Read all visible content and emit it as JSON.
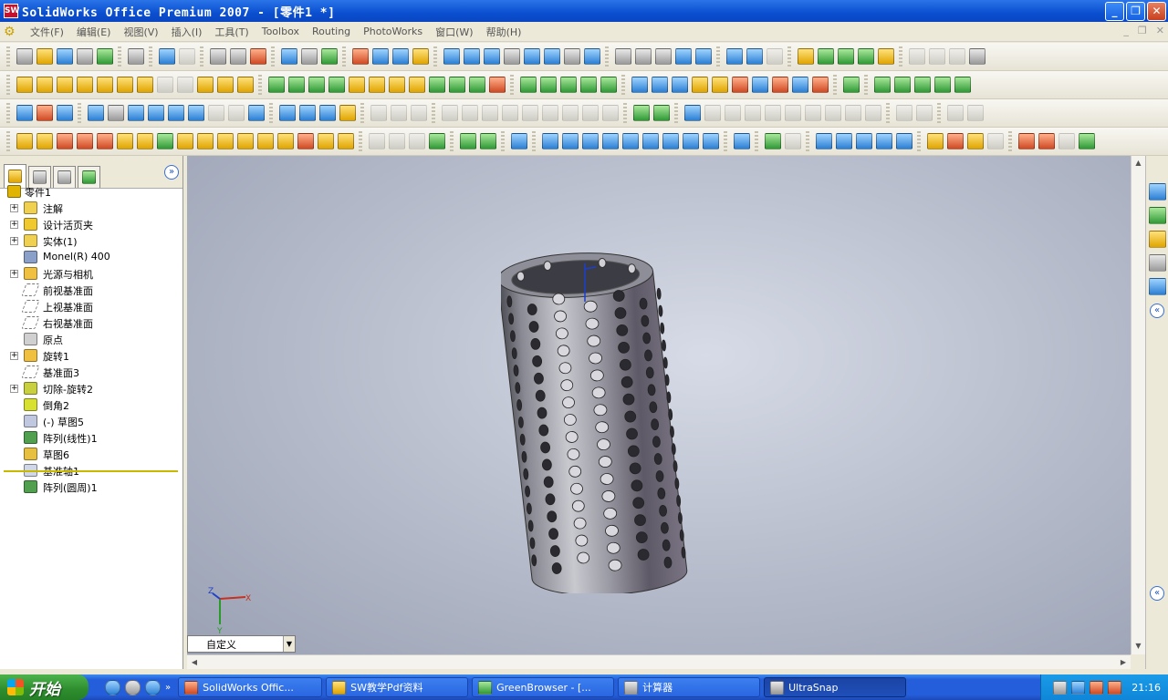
{
  "window": {
    "title": "SolidWorks Office Premium 2007 - [零件1 *]",
    "app_icon": "SW"
  },
  "window_buttons": {
    "minimize": "_",
    "maximize": "❐",
    "close": "✕"
  },
  "menus": [
    "文件(F)",
    "编辑(E)",
    "视图(V)",
    "插入(I)",
    "工具(T)",
    "Toolbox",
    "Routing",
    "PhotoWorks",
    "窗口(W)",
    "帮助(H)"
  ],
  "mdi_controls": {
    "minimize": "_",
    "restore": "❐",
    "close": "✕"
  },
  "tree_tabs": [
    "feature-manager",
    "property-manager",
    "configuration-manager",
    "display-manager"
  ],
  "feature_tree": [
    {
      "label": "零件1",
      "icon": "part-icon",
      "expandable": false,
      "root": true,
      "color": "#e0b400"
    },
    {
      "label": "注解",
      "icon": "annotations-icon",
      "expandable": true,
      "color": "#f0d050"
    },
    {
      "label": "设计活页夹",
      "icon": "design-binder-icon",
      "expandable": true,
      "color": "#f0c830"
    },
    {
      "label": "实体(1)",
      "icon": "solid-bodies-icon",
      "expandable": true,
      "color": "#f0d050"
    },
    {
      "label": "Monel(R) 400",
      "icon": "material-icon",
      "expandable": false,
      "color": "#8aa0c8"
    },
    {
      "label": "光源与相机",
      "icon": "lights-cameras-icon",
      "expandable": true,
      "color": "#f0c040"
    },
    {
      "label": "前视基准面",
      "icon": "plane-icon",
      "expandable": false,
      "plane": true
    },
    {
      "label": "上视基准面",
      "icon": "plane-icon",
      "expandable": false,
      "plane": true
    },
    {
      "label": "右视基准面",
      "icon": "plane-icon",
      "expandable": false,
      "plane": true
    },
    {
      "label": "原点",
      "icon": "origin-icon",
      "expandable": false,
      "color": "#d0d0d0"
    },
    {
      "label": "旋转1",
      "icon": "revolve-icon",
      "expandable": true,
      "color": "#f0c040"
    },
    {
      "label": "基准面3",
      "icon": "plane-icon",
      "expandable": false,
      "plane": true
    },
    {
      "label": "切除-旋转2",
      "icon": "cut-revolve-icon",
      "expandable": true,
      "color": "#c8d040"
    },
    {
      "label": "倒角2",
      "icon": "chamfer-icon",
      "expandable": false,
      "color": "#d8e030"
    },
    {
      "label": "(-) 草图5",
      "icon": "sketch-icon",
      "expandable": false,
      "color": "#c0c8e0"
    },
    {
      "label": "阵列(线性)1",
      "icon": "linear-pattern-icon",
      "expandable": false,
      "color": "#50a050"
    },
    {
      "label": "草图6",
      "icon": "sketch-icon",
      "expandable": false,
      "color": "#e8c040"
    },
    {
      "label": "基准轴1",
      "icon": "axis-icon",
      "expandable": false,
      "color": "#d0d8e8"
    },
    {
      "label": "阵列(圆周)1",
      "icon": "circular-pattern-icon",
      "expandable": false,
      "color": "#50a050"
    }
  ],
  "view_orientation": {
    "value": "自定义"
  },
  "triad": {
    "x": "X",
    "y": "Y",
    "z": "Z"
  },
  "taskbar": {
    "start_label": "开始",
    "tasks": [
      {
        "label": "SolidWorks Offic...",
        "icon": "solidworks-icon",
        "active": false
      },
      {
        "label": "SW教学Pdf资料",
        "icon": "folder-icon",
        "active": false
      },
      {
        "label": "GreenBrowser - [...",
        "icon": "browser-icon",
        "active": false
      },
      {
        "label": "计算器",
        "icon": "calculator-icon",
        "active": false
      },
      {
        "label": "UltraSnap",
        "icon": "ultrasnap-icon",
        "active": true
      }
    ],
    "clock": "21:16"
  }
}
